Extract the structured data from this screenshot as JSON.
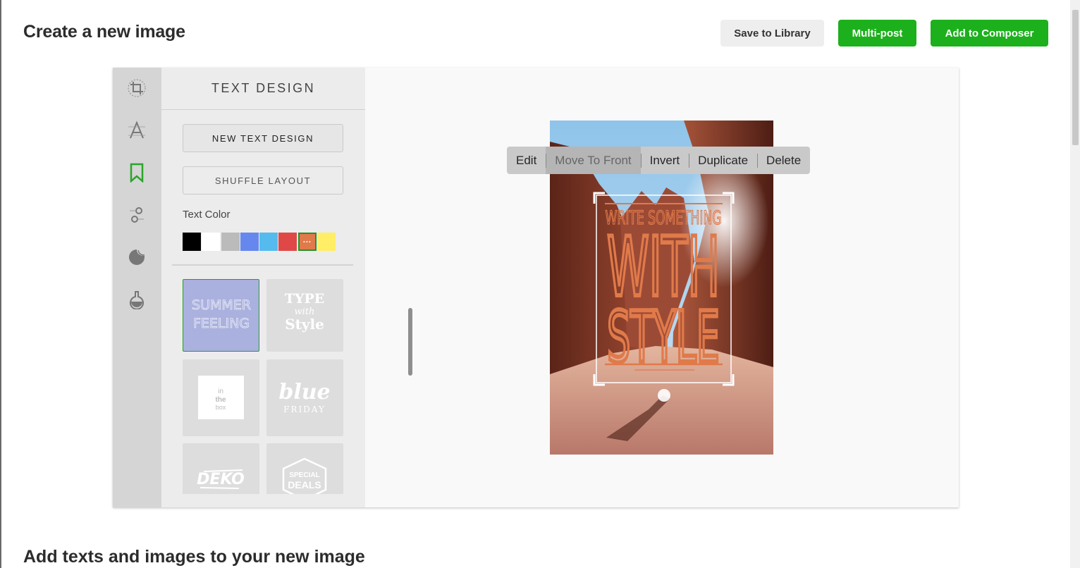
{
  "header": {
    "title": "Create a new image",
    "save_library": "Save to Library",
    "multi_post": "Multi-post",
    "add_composer": "Add to Composer"
  },
  "toolrail": {
    "icons": [
      "crop-icon",
      "text-icon",
      "bookmark-icon",
      "adjust-icon",
      "sticker-icon",
      "flask-icon"
    ],
    "active": "bookmark-icon"
  },
  "panel": {
    "title": "TEXT DESIGN",
    "new_text_design": "NEW TEXT DESIGN",
    "shuffle_layout": "SHUFFLE LAYOUT",
    "text_color_label": "Text Color",
    "swatches": [
      "#000000",
      "#ffffff",
      "#bbbbbb",
      "#6688ee",
      "#55bbee",
      "#e04848",
      "#e07a4a",
      "#ffee66"
    ],
    "selected_swatch_glyph": "···",
    "templates": [
      {
        "line1": "SUMMER",
        "line2": "FEELING"
      },
      {
        "line1": "TYPE",
        "line2": "with",
        "line3": "Style"
      },
      {
        "line1": "in",
        "line2": "the",
        "line3": "box"
      },
      {
        "line1": "blue",
        "line2": "FRIDAY"
      },
      {
        "line1": "DEKO"
      },
      {
        "line1": "SPECIAL",
        "line2": "DEALS"
      }
    ]
  },
  "canvas": {
    "context_menu": [
      "Edit",
      "Move To Front",
      "Invert",
      "Duplicate",
      "Delete"
    ],
    "text_overlay": {
      "line1": "WRITE SOMETHING",
      "line2": "WITH",
      "line3": "STYLE",
      "color": "#e07a4a"
    }
  },
  "section2": {
    "title": "Add texts and images to your new image"
  }
}
